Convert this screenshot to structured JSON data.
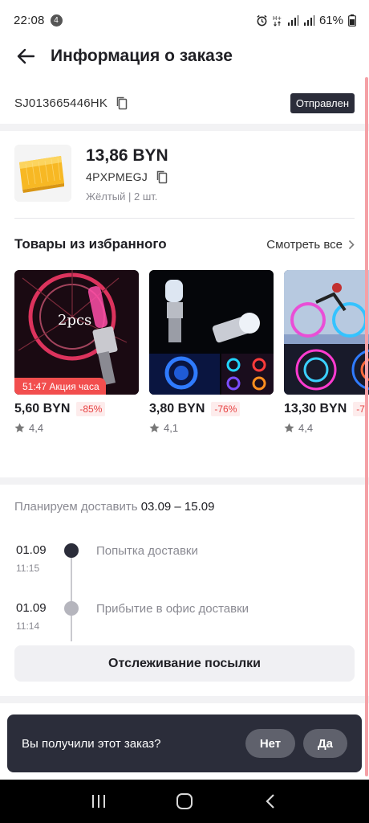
{
  "status_bar": {
    "time": "22:08",
    "notification_count": "4",
    "battery": "61%"
  },
  "header": {
    "title": "Информация о заказе"
  },
  "order": {
    "tracking_number": "SJ013665446HK",
    "status": "Отправлен"
  },
  "product": {
    "price": "13,86 BYN",
    "sku": "4PXPMEGJ",
    "variant": "Жёлтый | 2 шт."
  },
  "favorites": {
    "title": "Товары из избранного",
    "see_all": "Смотреть все",
    "items": [
      {
        "price": "5,60 BYN",
        "discount": "-85%",
        "rating": "4,4",
        "deal": "51:47 Акция часа",
        "image_text": "2pcs"
      },
      {
        "price": "3,80 BYN",
        "discount": "-76%",
        "rating": "4,1"
      },
      {
        "price": "13,30 BYN",
        "discount": "-7",
        "rating": "4,4"
      }
    ]
  },
  "delivery": {
    "plan_label": "Планируем доставить",
    "plan_dates": "03.09 – 15.09",
    "events": [
      {
        "date": "01.09",
        "time": "11:15",
        "text": "Попытка доставки",
        "active": true
      },
      {
        "date": "01.09",
        "time": "11:14",
        "text": "Прибытие в офис доставки",
        "active": false
      }
    ],
    "track_button": "Отслеживание посылки"
  },
  "received_prompt": {
    "question": "Вы получили этот заказ?",
    "no": "Нет",
    "yes": "Да"
  },
  "colors": {
    "dark": "#2b2d3a",
    "accent_red": "#f24e4e",
    "muted": "#8a8a92"
  }
}
